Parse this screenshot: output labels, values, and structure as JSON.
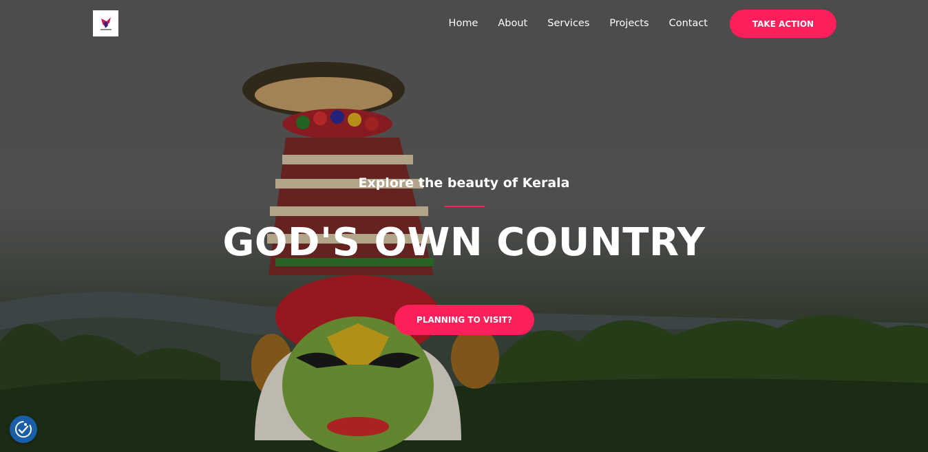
{
  "header": {
    "logo_icon": "brand-logo-icon",
    "nav_items": [
      {
        "label": "Home"
      },
      {
        "label": "About"
      },
      {
        "label": "Services"
      },
      {
        "label": "Projects"
      },
      {
        "label": "Contact"
      }
    ],
    "cta_label": "TAKE ACTION"
  },
  "hero": {
    "subtitle": "Explore the beauty of Kerala",
    "headline": "GOD'S OWN COUNTRY",
    "cta_label": "PLANNING TO VISIT?",
    "background_icon": "kathakali-dancer-photo"
  },
  "widgets": {
    "accessibility_icon": "accessibility-icon"
  },
  "colors": {
    "accent": "#ff1f5a",
    "text": "#ffffff",
    "widget": "#1a5ea8"
  }
}
